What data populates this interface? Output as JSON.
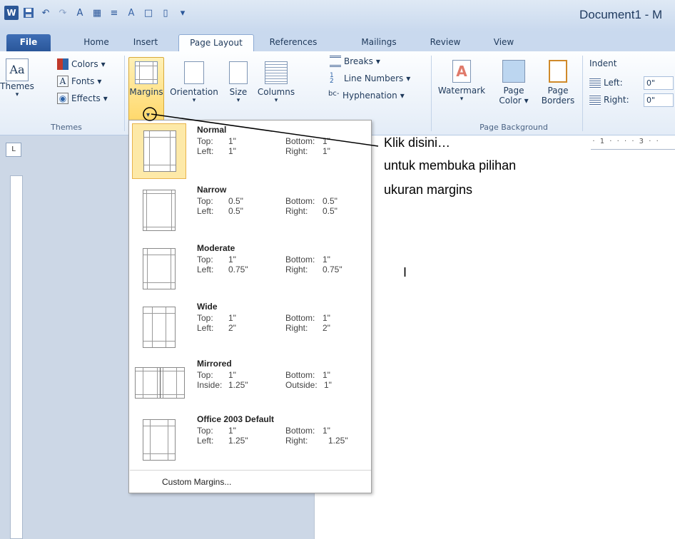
{
  "window": {
    "title": "Document1 - M"
  },
  "qat": {
    "icons": [
      "word-logo-icon",
      "save-icon",
      "undo-icon",
      "redo-icon",
      "format-painter-icon"
    ]
  },
  "tabs": [
    {
      "label": "File"
    },
    {
      "label": "Home"
    },
    {
      "label": "Insert"
    },
    {
      "label": "Page Layout"
    },
    {
      "label": "References"
    },
    {
      "label": "Mailings"
    },
    {
      "label": "Review"
    },
    {
      "label": "View"
    }
  ],
  "ribbon": {
    "themes_group": {
      "themes": "Themes",
      "colors": "Colors",
      "fonts": "Fonts",
      "effects": "Effects",
      "label": "Themes"
    },
    "page_setup": {
      "margins": "Margins",
      "orientation": "Orientation",
      "size": "Size",
      "columns": "Columns",
      "breaks": "Breaks",
      "line_numbers": "Line Numbers",
      "hyphenation": "Hyphenation"
    },
    "page_background": {
      "watermark": "Watermark",
      "page_color_1": "Page",
      "page_color_2": "Color",
      "page_borders_1": "Page",
      "page_borders_2": "Borders",
      "label": "Page Background"
    },
    "paragraph": {
      "indent": "Indent",
      "left_label": "Left:",
      "left_value": "0\"",
      "right_label": "Right:",
      "right_value": "0\""
    }
  },
  "margins_menu": {
    "items": [
      {
        "name": "Normal",
        "l1a": "Top:",
        "l1b": "1\"",
        "l1c": "Bottom:",
        "l1d": "1\"",
        "l2a": "Left:",
        "l2b": "1\"",
        "l2c": "Right:",
        "l2d": "1\""
      },
      {
        "name": "Narrow",
        "l1a": "Top:",
        "l1b": "0.5\"",
        "l1c": "Bottom:",
        "l1d": "0.5\"",
        "l2a": "Left:",
        "l2b": "0.5\"",
        "l2c": "Right:",
        "l2d": "0.5\""
      },
      {
        "name": "Moderate",
        "l1a": "Top:",
        "l1b": "1\"",
        "l1c": "Bottom:",
        "l1d": "1\"",
        "l2a": "Left:",
        "l2b": "0.75\"",
        "l2c": "Right:",
        "l2d": "0.75\""
      },
      {
        "name": "Wide",
        "l1a": "Top:",
        "l1b": "1\"",
        "l1c": "Bottom:",
        "l1d": "1\"",
        "l2a": "Left:",
        "l2b": "2\"",
        "l2c": "Right:",
        "l2d": "2\""
      },
      {
        "name": "Mirrored",
        "l1a": "Top:",
        "l1b": "1\"",
        "l1c": "Bottom:",
        "l1d": "1\"",
        "l2a": "Inside:",
        "l2b": "1.25\"",
        "l2c": "Outside:",
        "l2d": "1\""
      },
      {
        "name": "Office 2003 Default",
        "l1a": "Top:",
        "l1b": "1\"",
        "l1c": "Bottom:",
        "l1d": "1\"",
        "l2a": "Left:",
        "l2b": "1.25\"",
        "l2c": "Right:",
        "l2d": "1.25\""
      }
    ],
    "custom": "Custom Margins..."
  },
  "callout": {
    "line1": "Klik disini…",
    "line2": "untuk membuka pilihan",
    "line3": "ukuran margins"
  },
  "ruler": {
    "corner": "L",
    "marks": "· · 1 · · · · 3 · ·"
  },
  "colors": {
    "title_bar": "#c9d9ee",
    "file_tab": "#2a579a",
    "highlight": "#ffd86a"
  }
}
